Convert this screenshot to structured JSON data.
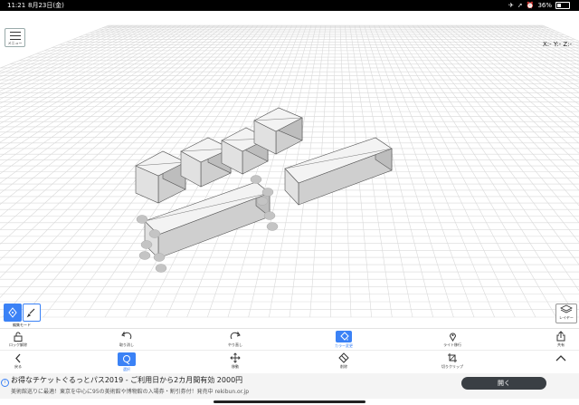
{
  "status_bar": {
    "time": "11:21",
    "date": "8月23日(金)",
    "battery": "36%"
  },
  "viewport": {
    "menu_label": "メニュー",
    "coords": "X:- Y:- Z:-"
  },
  "mode": {
    "label": "編集モード"
  },
  "layer": {
    "label": "レイヤー"
  },
  "toolbar_top": [
    {
      "key": "lock",
      "label": "ロック解除",
      "icon": "unlock-icon"
    },
    {
      "key": "undo",
      "label": "取り消し",
      "icon": "undo-icon"
    },
    {
      "key": "redo",
      "label": "やり直し",
      "icon": "redo-icon"
    },
    {
      "key": "color",
      "label": "カラー変更",
      "icon": "paint-bucket-icon",
      "active": true
    },
    {
      "key": "light",
      "label": "ライト移行",
      "icon": "location-pin-icon"
    },
    {
      "key": "share",
      "label": "共有",
      "icon": "share-icon"
    }
  ],
  "toolbar_bottom": [
    {
      "key": "back",
      "label": "戻る",
      "icon": "chevron-left-icon"
    },
    {
      "key": "select",
      "label": "選択",
      "icon": "select-icon",
      "active": true
    },
    {
      "key": "move",
      "label": "移動",
      "icon": "move-arrows-icon"
    },
    {
      "key": "erase",
      "label": "削除",
      "icon": "eraser-icon"
    },
    {
      "key": "clip",
      "label": "切りクリップ",
      "icon": "crop-icon"
    },
    {
      "key": "expand",
      "label": "",
      "icon": "chevron-up-icon"
    }
  ],
  "ad": {
    "title": "お得なチケットぐるっとパス2019 - ご利用日から2カ月間有効 2000円",
    "body": "美術館巡りに最適！東京を中心に95の美術館や博物館の入場券・割引券付！発売中 rekibun.or.jp",
    "button": "開く"
  },
  "colors": {
    "accent": "#3b82f6",
    "grid": "#d9d9d9",
    "box_top": "#f3f3f3",
    "box_side": "#cfcfcf",
    "box_front": "#bdbdbd",
    "handle": "#c4c4c4"
  }
}
